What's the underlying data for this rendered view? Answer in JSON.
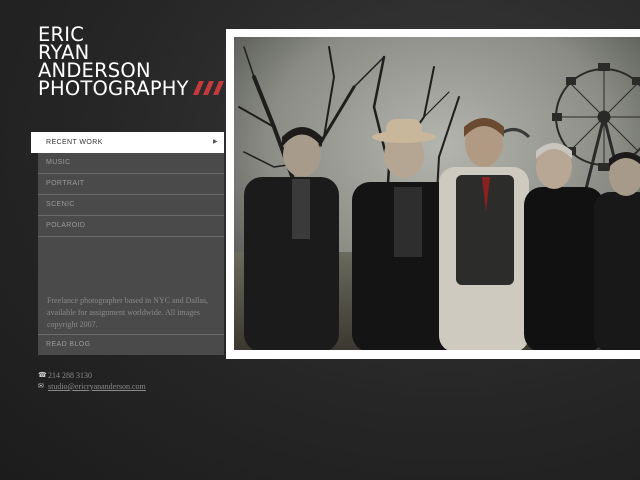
{
  "brand": {
    "lines": [
      "ERIC",
      "RYAN",
      "ANDERSON",
      "PHOTOGRAPHY"
    ],
    "slash_color": "#c43a3a"
  },
  "nav": {
    "items": [
      {
        "label": "RECENT WORK",
        "active": true
      },
      {
        "label": "MUSIC",
        "active": false
      },
      {
        "label": "PORTRAIT",
        "active": false
      },
      {
        "label": "SCENIC",
        "active": false
      },
      {
        "label": "POLAROID",
        "active": false
      }
    ],
    "about": "Freelance photographer based in NYC and Dallas, available for assignment worldwide. All images copyright 2007.",
    "blog_label": "READ BLOG"
  },
  "contact": {
    "phone": "214 288 3130",
    "email": "studio@ericryananderson.com",
    "phone_icon": "phone-icon",
    "email_icon": "envelope-icon"
  },
  "photo": {
    "subject": "band-portrait-fairground"
  }
}
